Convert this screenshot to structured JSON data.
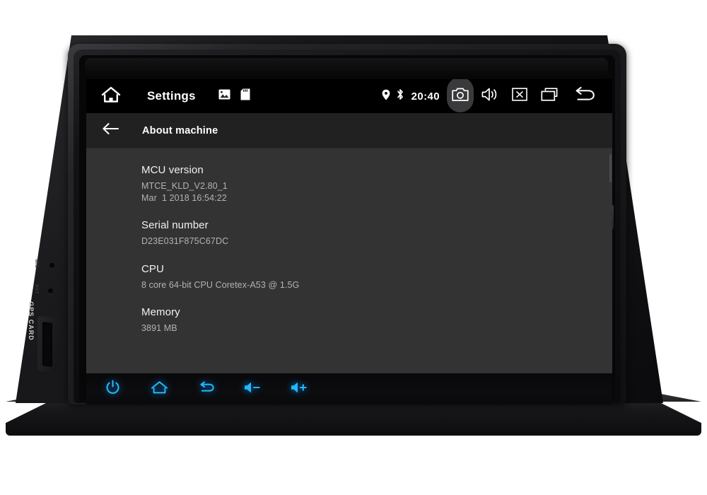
{
  "device": {
    "name": "car-head-unit",
    "left_panel": {
      "gps_slot_label": "GPS CARD",
      "pinhole_labels": [
        "MIC",
        "RST"
      ]
    }
  },
  "screen": {
    "statusbar": {
      "home_icon": "home-icon",
      "app_title": "Settings",
      "quick_icons": [
        {
          "name": "gallery-icon",
          "label": "Gallery"
        },
        {
          "name": "sd-card-icon",
          "label": "SD Card"
        }
      ],
      "indicators": [
        {
          "name": "location-icon",
          "label": "GPS"
        },
        {
          "name": "bluetooth-icon",
          "label": "Bluetooth"
        }
      ],
      "clock": "20:40",
      "buttons": [
        {
          "name": "camera-icon",
          "label": "Camera",
          "active": true
        },
        {
          "name": "volume-icon",
          "label": "Volume"
        },
        {
          "name": "close-box-icon",
          "label": "Close"
        },
        {
          "name": "recent-apps-icon",
          "label": "Recent apps"
        },
        {
          "name": "back-arrow-icon",
          "label": "Back"
        }
      ],
      "accent_highlight": "#3a3a3c",
      "background": "#000000"
    },
    "subheader": {
      "back_icon": "arrow-left-icon",
      "title": "About machine",
      "background": "#212121"
    },
    "content": {
      "background": "#333333",
      "items": [
        {
          "title": "MCU version",
          "value": "MTCE_KLD_V2.80_1\nMar  1 2018 16:54:22"
        },
        {
          "title": "Serial number",
          "value": "D23E031F875C67DC"
        },
        {
          "title": "CPU",
          "value": "8 core 64-bit CPU Coretex-A53 @ 1.5G"
        },
        {
          "title": "Memory",
          "value": "3891 MB"
        }
      ]
    }
  },
  "keybar": {
    "accent_color": "#22b8ff",
    "keys": [
      {
        "name": "power-key-icon",
        "label": "Power"
      },
      {
        "name": "home-key-icon",
        "label": "Home"
      },
      {
        "name": "back-key-icon",
        "label": "Back"
      },
      {
        "name": "volume-down-key-icon",
        "label": "Volume down"
      },
      {
        "name": "volume-up-key-icon",
        "label": "Volume up"
      }
    ]
  }
}
